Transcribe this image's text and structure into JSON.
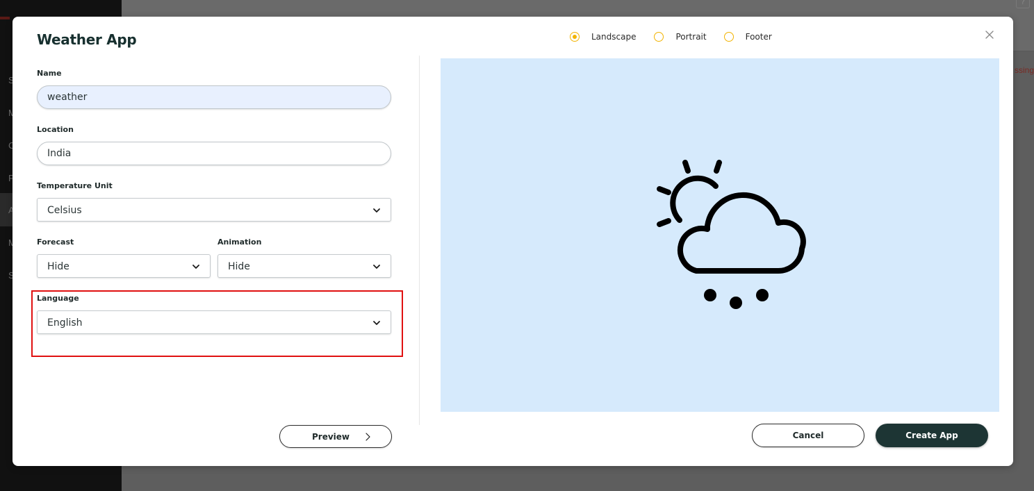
{
  "background": {
    "sidebar_letters": [
      "S",
      "M",
      "C",
      "P",
      "A",
      "M",
      "S"
    ],
    "help_label": "?",
    "missing_text": "ssing"
  },
  "modal": {
    "title": "Weather App",
    "layout_options": [
      {
        "label": "Landscape",
        "checked": true
      },
      {
        "label": "Portrait",
        "checked": false
      },
      {
        "label": "Footer",
        "checked": false
      }
    ],
    "accent_color": "#f2b300",
    "close_icon": "close-icon"
  },
  "form": {
    "name_label": "Name",
    "name_value": "weather",
    "location_label": "Location",
    "location_value": "India",
    "temperature_label": "Temperature Unit",
    "temperature_value": "Celsius",
    "forecast_label": "Forecast",
    "forecast_value": "Hide",
    "animation_label": "Animation",
    "animation_value": "Hide",
    "language_label": "Language",
    "language_value": "English"
  },
  "preview": {
    "button_label": "Preview",
    "background_color": "#d6eafc",
    "icon": "partly-cloudy-hail-icon"
  },
  "actions": {
    "cancel_label": "Cancel",
    "create_label": "Create App",
    "create_color": "#1d3534"
  }
}
